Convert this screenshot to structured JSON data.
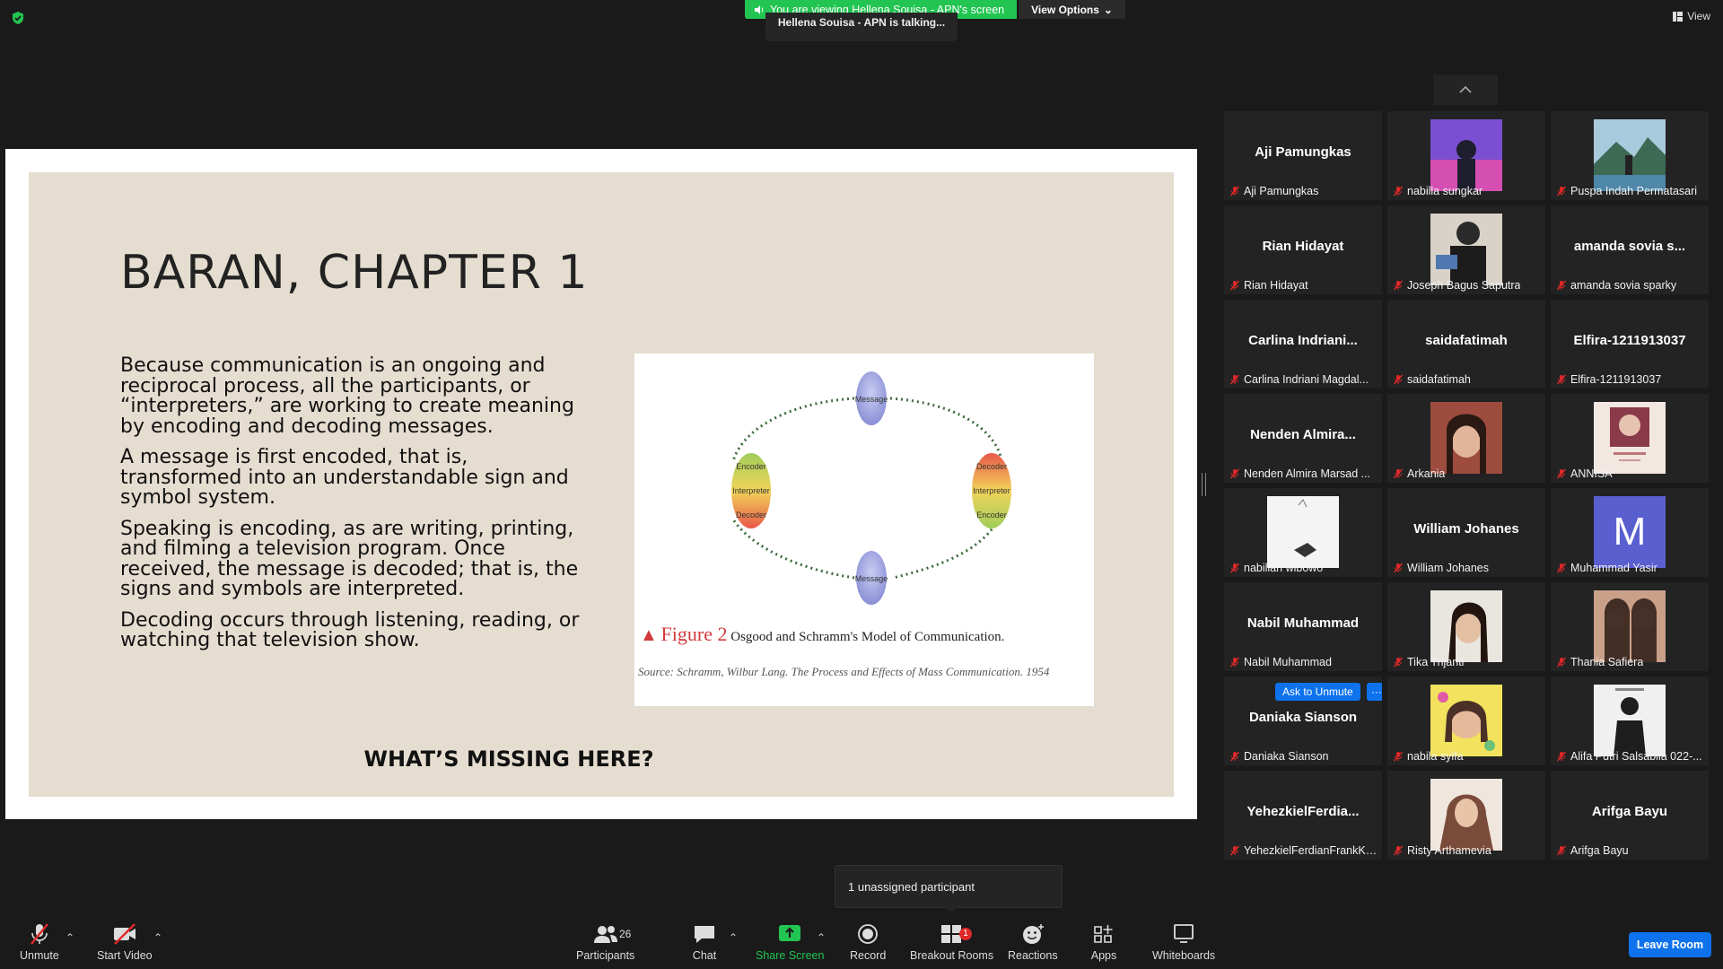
{
  "top": {
    "banner_text": "You are viewing Hellena Souisa - APN's screen",
    "view_options": "View Options",
    "talking": "Hellena Souisa - APN is talking...",
    "view_button": "View"
  },
  "slide": {
    "title": "BARAN, CHAPTER 1",
    "paragraphs": [
      "Because communication is an ongoing and reciprocal process, all the participants, or “interpreters,” are working to create meaning by encoding and decoding messages.",
      "A message is first encoded, that is, transformed into an understandable sign and symbol system.",
      "Speaking is encoding, as are writing, printing, and filming a television program. Once received, the message is decoded; that is, the signs and symbols are interpreted.",
      "Decoding occurs through listening, reading, or watching that television show."
    ],
    "question": "WHAT’S MISSING HERE?",
    "figure": {
      "label": "Figure 2",
      "caption": "Osgood and Schramm's Model of Communication.",
      "source": "Source: Schramm, Wilbur Lang. The Process and Effects of Mass Communication. 1954",
      "node_message_top": "Message",
      "node_message_bottom": "Message",
      "node_left": [
        "Encoder",
        "Interpreter",
        "Decoder"
      ],
      "node_right": [
        "Decoder",
        "Interpreter",
        "Encoder"
      ]
    }
  },
  "participants": [
    {
      "display": "Aji Pamungkas",
      "label": "Aji Pamungkas"
    },
    {
      "display": "",
      "label": "nabilla sungkar",
      "photo": "purple"
    },
    {
      "display": "",
      "label": "Puspa Indah Permatasari",
      "photo": "landscape"
    },
    {
      "display": "Rian Hidayat",
      "label": "Rian Hidayat"
    },
    {
      "display": "",
      "label": "Joseph Bagus Saputra",
      "photo": "person-dark"
    },
    {
      "display": "amanda sovia s...",
      "label": "amanda sovia sparky"
    },
    {
      "display": "Carlina Indriani...",
      "label": "Carlina Indriani Magdal..."
    },
    {
      "display": "saidafatimah",
      "label": "saidafatimah"
    },
    {
      "display": "Elfira-1211913037",
      "label": "Elfira-1211913037"
    },
    {
      "display": "Nenden Almira...",
      "label": "Nenden Almira Marsad ..."
    },
    {
      "display": "",
      "label": "Arkania",
      "photo": "portrait"
    },
    {
      "display": "",
      "label": "ANNISA",
      "photo": "poster"
    },
    {
      "display": "",
      "label": "nabillah wibowo",
      "photo": "white"
    },
    {
      "display": "William Johanes",
      "label": "William Johanes"
    },
    {
      "display": "",
      "label": "Muhammad Yasir",
      "avatar_letter": "M"
    },
    {
      "display": "Nabil Muhammad",
      "label": "Nabil Muhammad"
    },
    {
      "display": "",
      "label": "Tika Trijanti",
      "photo": "portrait-light"
    },
    {
      "display": "",
      "label": "Thania Safiera",
      "photo": "group"
    },
    {
      "display": "Daniaka Sianson",
      "label": "Daniaka Sianson",
      "ask_unmute": "Ask to Unmute",
      "more": "···"
    },
    {
      "display": "",
      "label": "nabila syifa",
      "photo": "sticker"
    },
    {
      "display": "",
      "label": "Alifa Putri Salsabila 022-...",
      "photo": "figure"
    },
    {
      "display": "YehezkielFerdia...",
      "label": "YehezkielFerdianFrankKe..."
    },
    {
      "display": "",
      "label": "Risty Arthamevia",
      "photo": "hijab"
    },
    {
      "display": "Arifga Bayu",
      "label": "Arifga Bayu"
    }
  ],
  "tooltip": {
    "unassigned": "1 unassigned participant"
  },
  "toolbar": {
    "unmute": "Unmute",
    "start_video": "Start Video",
    "participants": "Participants",
    "participants_count": "26",
    "chat": "Chat",
    "share_screen": "Share Screen",
    "record": "Record",
    "breakout_rooms": "Breakout Rooms",
    "breakout_badge": "1",
    "reactions": "Reactions",
    "apps": "Apps",
    "whiteboards": "Whiteboards",
    "leave": "Leave Room"
  },
  "colors": {
    "accent_green": "#23c552",
    "accent_blue": "#0e72ed",
    "mute_red": "#e02828"
  }
}
